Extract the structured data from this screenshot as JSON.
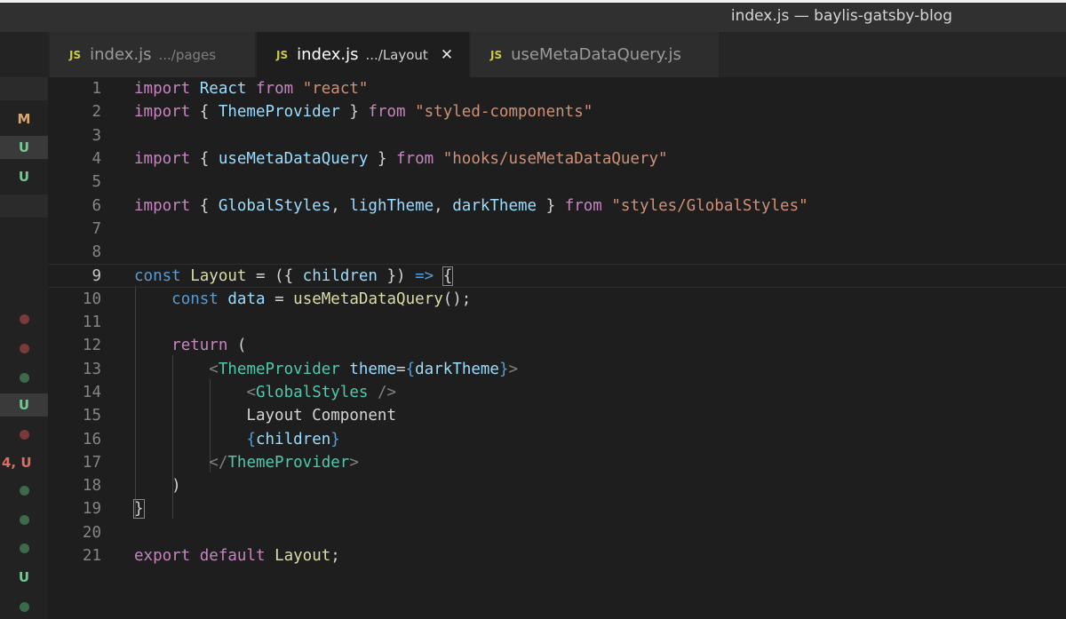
{
  "window": {
    "title": "index.js — baylis-gatsby-blog"
  },
  "tabs": [
    {
      "badge": "JS",
      "name": "index.js",
      "dir": ".../pages",
      "active": false
    },
    {
      "badge": "JS",
      "name": "index.js",
      "dir": ".../Layout",
      "active": true,
      "close": "✕"
    },
    {
      "badge": "JS",
      "name": "useMetaDataQuery.js",
      "dir": "",
      "active": false
    }
  ],
  "gutter": {
    "badges": [
      "M",
      "U",
      "U",
      "U",
      "4, U",
      "U"
    ],
    "colors": {
      "modified": "#d9a86c",
      "untracked": "#73c991",
      "error": "#e06c62",
      "dot_red": "#7a3a36",
      "dot_green": "#3d6b49"
    }
  },
  "editor": {
    "current_line": 9,
    "lines": [
      {
        "n": "1",
        "tokens": [
          [
            "kw",
            "import"
          ],
          [
            "pn",
            " "
          ],
          [
            "var",
            "React"
          ],
          [
            "pn",
            " "
          ],
          [
            "kw",
            "from"
          ],
          [
            "pn",
            " "
          ],
          [
            "str",
            "\"react\""
          ]
        ]
      },
      {
        "n": "2",
        "tokens": [
          [
            "kw",
            "import"
          ],
          [
            "pn",
            " { "
          ],
          [
            "var",
            "ThemeProvider"
          ],
          [
            "pn",
            " } "
          ],
          [
            "kw",
            "from"
          ],
          [
            "pn",
            " "
          ],
          [
            "str",
            "\"styled-components\""
          ]
        ]
      },
      {
        "n": "3",
        "tokens": []
      },
      {
        "n": "4",
        "tokens": [
          [
            "kw",
            "import"
          ],
          [
            "pn",
            " { "
          ],
          [
            "var",
            "useMetaDataQuery"
          ],
          [
            "pn",
            " } "
          ],
          [
            "kw",
            "from"
          ],
          [
            "pn",
            " "
          ],
          [
            "str",
            "\"hooks/useMetaDataQuery\""
          ]
        ]
      },
      {
        "n": "5",
        "tokens": []
      },
      {
        "n": "6",
        "tokens": [
          [
            "kw",
            "import"
          ],
          [
            "pn",
            " { "
          ],
          [
            "var",
            "GlobalStyles"
          ],
          [
            "pn",
            ", "
          ],
          [
            "var",
            "lighTheme"
          ],
          [
            "pn",
            ", "
          ],
          [
            "var",
            "darkTheme"
          ],
          [
            "pn",
            " } "
          ],
          [
            "kw",
            "from"
          ],
          [
            "pn",
            " "
          ],
          [
            "str",
            "\"styles/GlobalStyles\""
          ]
        ]
      },
      {
        "n": "7",
        "tokens": []
      },
      {
        "n": "8",
        "tokens": []
      },
      {
        "n": "9",
        "tokens": [
          [
            "kb",
            "const"
          ],
          [
            "pn",
            " "
          ],
          [
            "fn",
            "Layout"
          ],
          [
            "pn",
            " = ({ "
          ],
          [
            "var",
            "children"
          ],
          [
            "pn",
            " }) "
          ],
          [
            "kb",
            "=>"
          ],
          [
            "pn",
            " "
          ],
          [
            "brk",
            "{"
          ]
        ]
      },
      {
        "n": "10",
        "tokens": [
          [
            "pn",
            "    "
          ],
          [
            "kb",
            "const"
          ],
          [
            "pn",
            " "
          ],
          [
            "var",
            "data"
          ],
          [
            "pn",
            " = "
          ],
          [
            "fn",
            "useMetaDataQuery"
          ],
          [
            "pn",
            "();"
          ]
        ]
      },
      {
        "n": "11",
        "tokens": []
      },
      {
        "n": "12",
        "tokens": [
          [
            "pn",
            "    "
          ],
          [
            "kw",
            "return"
          ],
          [
            "pn",
            " ("
          ]
        ]
      },
      {
        "n": "13",
        "tokens": [
          [
            "pn",
            "        "
          ],
          [
            "ang",
            "<"
          ],
          [
            "tag",
            "ThemeProvider"
          ],
          [
            "pn",
            " "
          ],
          [
            "var",
            "theme"
          ],
          [
            "pn",
            "="
          ],
          [
            "kb",
            "{"
          ],
          [
            "var",
            "darkTheme"
          ],
          [
            "kb",
            "}"
          ],
          [
            "ang",
            ">"
          ]
        ]
      },
      {
        "n": "14",
        "tokens": [
          [
            "pn",
            "            "
          ],
          [
            "ang",
            "<"
          ],
          [
            "tag",
            "GlobalStyles"
          ],
          [
            "pn",
            " "
          ],
          [
            "ang",
            "/>"
          ]
        ]
      },
      {
        "n": "15",
        "tokens": [
          [
            "pn",
            "            Layout Component"
          ]
        ]
      },
      {
        "n": "16",
        "tokens": [
          [
            "pn",
            "            "
          ],
          [
            "kb",
            "{"
          ],
          [
            "var",
            "children"
          ],
          [
            "kb",
            "}"
          ]
        ]
      },
      {
        "n": "17",
        "tokens": [
          [
            "pn",
            "        "
          ],
          [
            "ang",
            "</"
          ],
          [
            "tag",
            "ThemeProvider"
          ],
          [
            "ang",
            ">"
          ]
        ]
      },
      {
        "n": "18",
        "tokens": [
          [
            "pn",
            "    )"
          ]
        ]
      },
      {
        "n": "19",
        "tokens": [
          [
            "brk",
            "}"
          ]
        ]
      },
      {
        "n": "20",
        "tokens": []
      },
      {
        "n": "21",
        "tokens": [
          [
            "kw",
            "export"
          ],
          [
            "pn",
            " "
          ],
          [
            "kw",
            "default"
          ],
          [
            "pn",
            " "
          ],
          [
            "fn",
            "Layout"
          ],
          [
            "pn",
            ";"
          ]
        ]
      }
    ]
  }
}
